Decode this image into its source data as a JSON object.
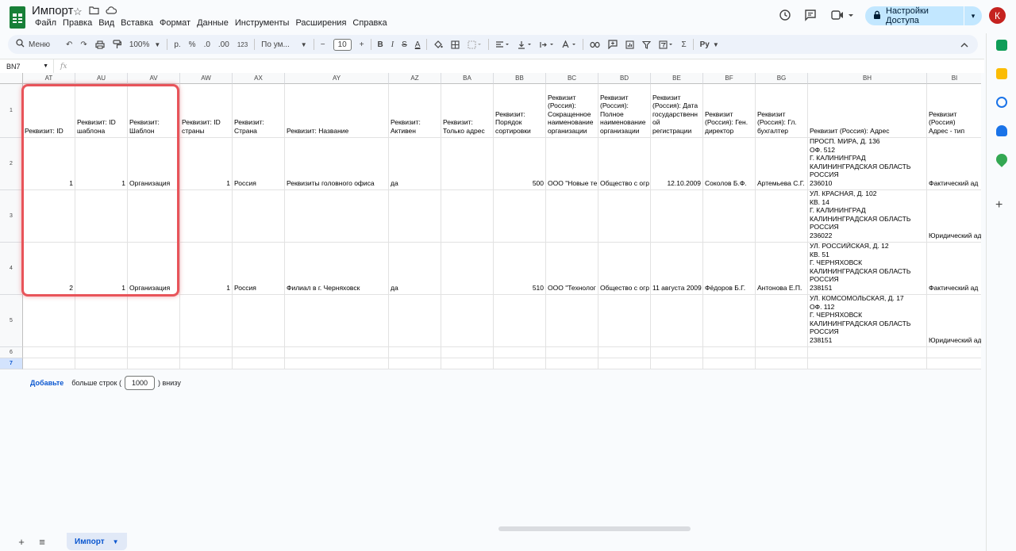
{
  "app": {
    "doc_title": "Импорт",
    "menu": [
      "Файл",
      "Правка",
      "Вид",
      "Вставка",
      "Формат",
      "Данные",
      "Инструменты",
      "Расширения",
      "Справка"
    ],
    "share_label": "Настройки Доступа",
    "avatar_letter": "К"
  },
  "toolbar": {
    "search_label": "Меню",
    "zoom": "100%",
    "currency": "р.",
    "percent": "%",
    "dec_decrease": ".0",
    "dec_increase": ".00",
    "number_format": "123",
    "font": "По ум...",
    "font_size": "10",
    "bold": "B",
    "italic": "I",
    "strikethrough": "S",
    "text_color": "A",
    "function": "Σ",
    "input_tools": "Ру"
  },
  "formula_bar": {
    "name_box": "BN7",
    "fx": "fx"
  },
  "columns": [
    "AT",
    "AU",
    "AV",
    "AW",
    "AX",
    "AY",
    "AZ",
    "BA",
    "BB",
    "BC",
    "BD",
    "BE",
    "BF",
    "BG",
    "BH",
    "BI"
  ],
  "rows": [
    "1",
    "2",
    "3",
    "4",
    "5",
    "6",
    "7"
  ],
  "selected_row": "7",
  "cells": {
    "r1": [
      "Реквизит: ID",
      "Реквизит: ID\nшаблона",
      "Реквизит:\nШаблон",
      "Реквизит: ID\nстраны",
      "Реквизит:\nСтрана",
      "Реквизит: Название",
      "Реквизит:\nАктивен",
      "Реквизит:\nТолько адрес",
      "Реквизит:\nПорядок\nсортировки",
      "Реквизит\n(Россия):\nСокращенное\nнаименование\nорганизации",
      "Реквизит\n(Россия):\nПолное\nнаименование\nорганизации",
      "Реквизит\n(Россия): Дата\nгосударственн\nой\nрегистрации",
      "Реквизит\n(Россия): Ген.\nдиректор",
      "Реквизит\n(Россия): Гл.\nбухгалтер",
      "Реквизит (Россия): Адрес",
      "Реквизит\n(Россия)\nАдрес - тип"
    ],
    "r2": [
      "1",
      "1",
      "Организация",
      "1",
      "Россия",
      "Реквизиты головного офиса",
      "да",
      "",
      "500",
      "ООО \"Новые те",
      "Общество с огр",
      "12.10.2009",
      "Соколов Б.Ф.",
      "Артемьева С.Г.",
      "ПРОСП. МИРА, Д. 136\nОФ. 512\nГ. КАЛИНИНГРАД\nКАЛИНИНГРАДСКАЯ ОБЛАСТЬ\nРОССИЯ\n236010",
      "Фактический ад"
    ],
    "r3": [
      "",
      "",
      "",
      "",
      "",
      "",
      "",
      "",
      "",
      "",
      "",
      "",
      "",
      "",
      "УЛ. КРАСНАЯ, Д. 102\nКВ. 14\nГ. КАЛИНИНГРАД\nКАЛИНИНГРАДСКАЯ ОБЛАСТЬ\nРОССИЯ\n236022",
      "Юридический ад"
    ],
    "r4": [
      "2",
      "1",
      "Организация",
      "1",
      "Россия",
      "Филиал в г. Черняховск",
      "да",
      "",
      "510",
      "ООО \"Технолог",
      "Общество с огр",
      "11 августа 2009",
      "Фёдоров Б.Г.",
      "Антонова Е.П.",
      "УЛ. РОССИЙСКАЯ, Д. 12\nКВ. 51\nГ. ЧЕРНЯХОВСК\nКАЛИНИНГРАДСКАЯ ОБЛАСТЬ\nРОССИЯ\n238151",
      "Фактический ад"
    ],
    "r5": [
      "",
      "",
      "",
      "",
      "",
      "",
      "",
      "",
      "",
      "",
      "",
      "",
      "",
      "",
      "УЛ. КОМСОМОЛЬСКАЯ, Д. 17\nОФ. 112\nГ. ЧЕРНЯХОВСК\nКАЛИНИНГРАДСКАЯ ОБЛАСТЬ\nРОССИЯ\n238151",
      "Юридический ад"
    ]
  },
  "add_rows": {
    "button": "Добавьте",
    "text_before": "больше строк (",
    "count": "1000",
    "text_after": ") внизу"
  },
  "sheet_tab": "Импорт",
  "colors": {
    "highlight": "#e8545a",
    "accent": "#0b57d0",
    "share_bg": "#c2e7ff"
  }
}
